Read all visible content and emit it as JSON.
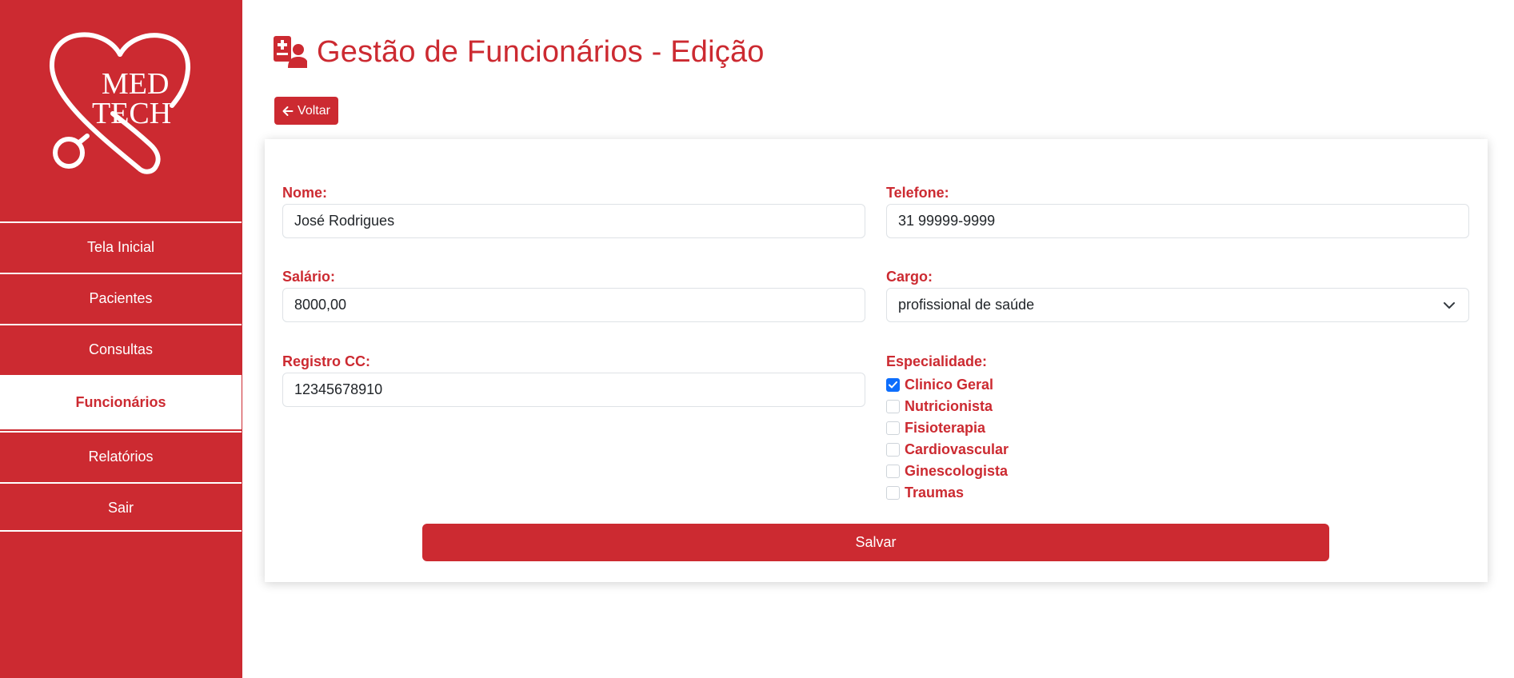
{
  "brand": {
    "line1": "MED",
    "line2": "TECH",
    "color": "#cc2a31"
  },
  "sidebar": {
    "items": [
      {
        "label": "Tela Inicial",
        "active": false
      },
      {
        "label": "Pacientes",
        "active": false
      },
      {
        "label": "Consultas",
        "active": false
      },
      {
        "label": "Funcionários",
        "active": true
      },
      {
        "label": "Relatórios",
        "active": false
      },
      {
        "label": "Sair",
        "active": false
      }
    ]
  },
  "header": {
    "title": "Gestão de Funcionários - Edição",
    "icon": "user-medical-icon"
  },
  "back_button": {
    "label": "Voltar",
    "icon": "arrow-left-icon"
  },
  "form": {
    "nome": {
      "label": "Nome:",
      "value": "José Rodrigues"
    },
    "telefone": {
      "label": "Telefone:",
      "value": "31 99999-9999"
    },
    "salario": {
      "label": "Salário:",
      "value": "8000,00"
    },
    "cargo": {
      "label": "Cargo:",
      "value": "profissional de saúde",
      "icon": "chevron-down-icon"
    },
    "registro": {
      "label": "Registro CC:",
      "value": "12345678910"
    },
    "especialidade": {
      "label": "Especialidade:",
      "options": [
        {
          "label": "Clinico Geral",
          "checked": true
        },
        {
          "label": "Nutricionista",
          "checked": false
        },
        {
          "label": "Fisioterapia",
          "checked": false
        },
        {
          "label": "Cardiovascular",
          "checked": false
        },
        {
          "label": "Ginescologista",
          "checked": false
        },
        {
          "label": "Traumas",
          "checked": false
        }
      ]
    },
    "save_label": "Salvar"
  }
}
